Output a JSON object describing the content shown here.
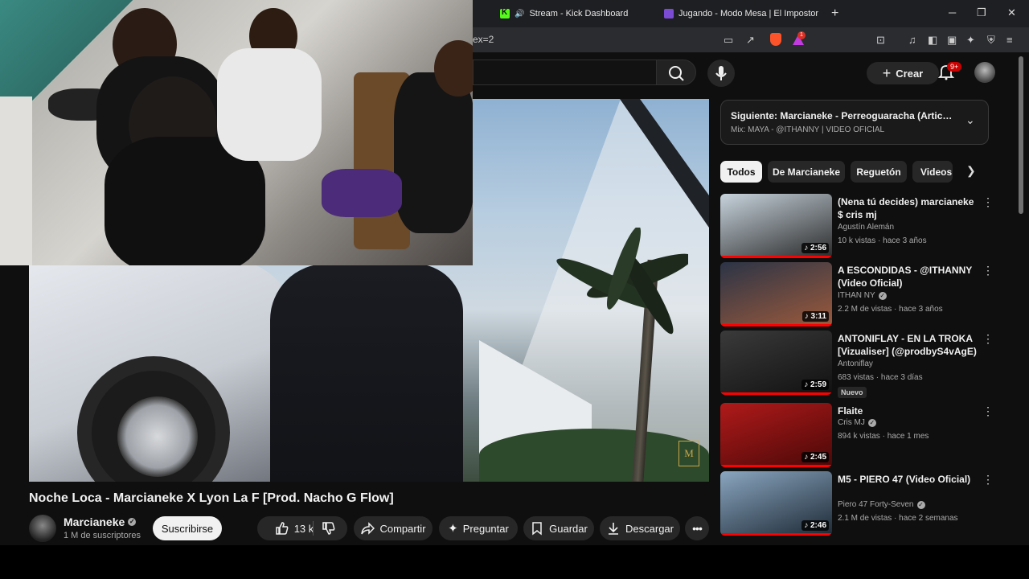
{
  "browser": {
    "tabs": [
      {
        "label": "Stream - Kick Dashboard",
        "icon": "kick-icon"
      },
      {
        "label": "Jugando - Modo Mesa | El Impostor",
        "icon": "modo-mesa-icon"
      }
    ],
    "url_fragment": "ex=2",
    "reward_badge": "1"
  },
  "youtube": {
    "create_label": "Crear",
    "notifications_badge": "9+"
  },
  "video": {
    "title": "Noche Loca - Marcianeke X Lyon La F [Prod. Nacho G Flow]",
    "watermark": "M",
    "channel": "Marcianeke",
    "subscribers": "1 M de suscriptores",
    "subscribe_label": "Suscribirse",
    "likes": "13 k",
    "share_label": "Compartir",
    "ask_label": "Preguntar",
    "save_label": "Guardar",
    "download_label": "Descargar"
  },
  "next": {
    "title": "Siguiente: Marcianeke - Perreoguaracha (Artico.Au...",
    "subtitle": "Mix: MAYA - @ITHANNY | VIDEO OFICIAL"
  },
  "chips": [
    "Todos",
    "De Marcianeke",
    "Reguetón",
    "Videos"
  ],
  "recommendations": [
    {
      "title": "(Nena tú decides) marcianeke $ cris mj",
      "channel": "Agustín Alemán",
      "verified": false,
      "meta": "10 k vistas · hace 3 años",
      "duration": "2:56",
      "badge": "",
      "colors": [
        "#c7d3dc",
        "#2a2a2a"
      ]
    },
    {
      "title": "A ESCONDIDAS - @ITHANNY (Video Oficial)",
      "channel": "ITHAN NY",
      "verified": true,
      "meta": "2.2 M de vistas · hace 3 años",
      "duration": "3:11",
      "badge": "",
      "colors": [
        "#2b3446",
        "#9c5a3c"
      ]
    },
    {
      "title": "ANTONIFLAY - EN LA TROKA [Vizualiser] (@prodbyS4vAgE)",
      "channel": "Antoniflay",
      "verified": false,
      "meta": "683 vistas · hace 3 días",
      "duration": "2:59",
      "badge": "Nuevo",
      "colors": [
        "#3a3a3a",
        "#111111"
      ]
    },
    {
      "title": "Flaite",
      "channel": "Cris MJ",
      "verified": true,
      "meta": "894 k vistas · hace 1 mes",
      "duration": "2:45",
      "badge": "",
      "colors": [
        "#b01a1a",
        "#4a0808"
      ]
    },
    {
      "title": "M5 - PIERO 47 (Video Oficial)",
      "channel": "Piero 47 Forty-Seven",
      "verified": true,
      "meta": "2.1 M de vistas · hace 2 semanas",
      "duration": "2:46",
      "badge": "",
      "colors": [
        "#8aa6c0",
        "#1e2a36"
      ]
    }
  ]
}
